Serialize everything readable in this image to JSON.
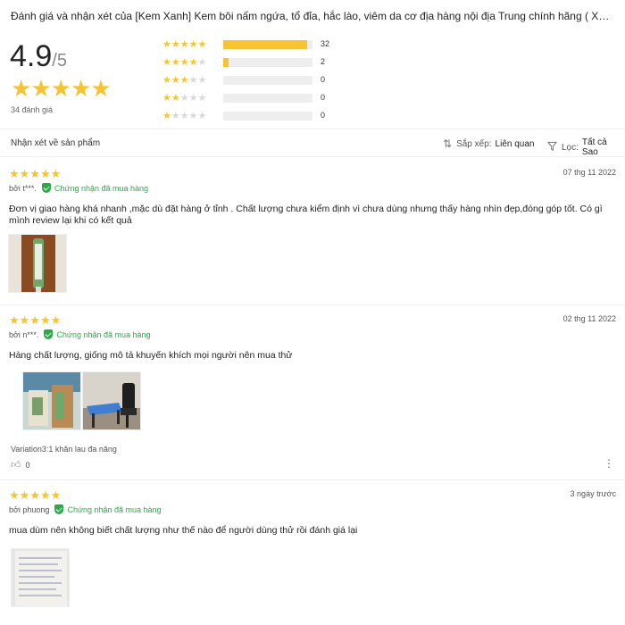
{
  "header": {
    "title": "Đánh giá và nhận xét của [Kem Xanh] Kem bôi nấm ngứa, tổ đỉa, hắc lào, viêm da cơ địa hàng nội địa Trung chính hãng ( XD) - Chuy..."
  },
  "summary": {
    "average": "4.9",
    "max": "/5",
    "total_label": "34 đánh giá",
    "bars": [
      {
        "stars": 5,
        "count": "32",
        "fraction": 0.94
      },
      {
        "stars": 4,
        "count": "2",
        "fraction": 0.06
      },
      {
        "stars": 3,
        "count": "0",
        "fraction": 0
      },
      {
        "stars": 2,
        "count": "0",
        "fraction": 0
      },
      {
        "stars": 1,
        "count": "0",
        "fraction": 0
      }
    ]
  },
  "filter_bar": {
    "label": "Nhận xét về sản phẩm",
    "sort_label": "Sắp xếp:",
    "sort_value": "Liên quan",
    "filter_label": "Lọc:",
    "filter_value": "Tất cả Sao"
  },
  "reviews": [
    {
      "rating": 5,
      "author": "bởi t***.",
      "verified": "Chứng nhận đã mua hàng",
      "date": "07 thg 11 2022",
      "text": "Đơn vị giao hàng khá nhanh ,mặc dù đặt hàng ở tỉnh . Chất lượng chưa kiểm định vì chưa dùng nhưng thấy hàng nhìn đẹp,đóng góp tốt. Có gì mình review lại khi có kết quả"
    },
    {
      "rating": 5,
      "author": "bởi n***.",
      "verified": "Chứng nhận đã mua hàng",
      "date": "02 thg 11 2022",
      "text": "Hàng chất lượng, giống mô tả khuyến khích mọi người nên mua thử",
      "variation": "Variation3:1 khăn lau đa năng",
      "likes": "0"
    },
    {
      "rating": 5,
      "author": "bởi phuong",
      "verified": "Chứng nhận đã mua hàng",
      "date": "3 ngày trước",
      "text": "mua dùm nên không biết chất lượng như thế nào  để người dùng thử rồi đánh giá lại"
    }
  ],
  "icons": {
    "star": "star-icon",
    "sort": "sort-arrows-icon",
    "filter": "funnel-icon",
    "verified": "shield-check-icon",
    "like": "thumbs-up-icon",
    "more": "vertical-dots-icon"
  },
  "colors": {
    "star": "#f6c432",
    "verified": "#2ea84a"
  }
}
